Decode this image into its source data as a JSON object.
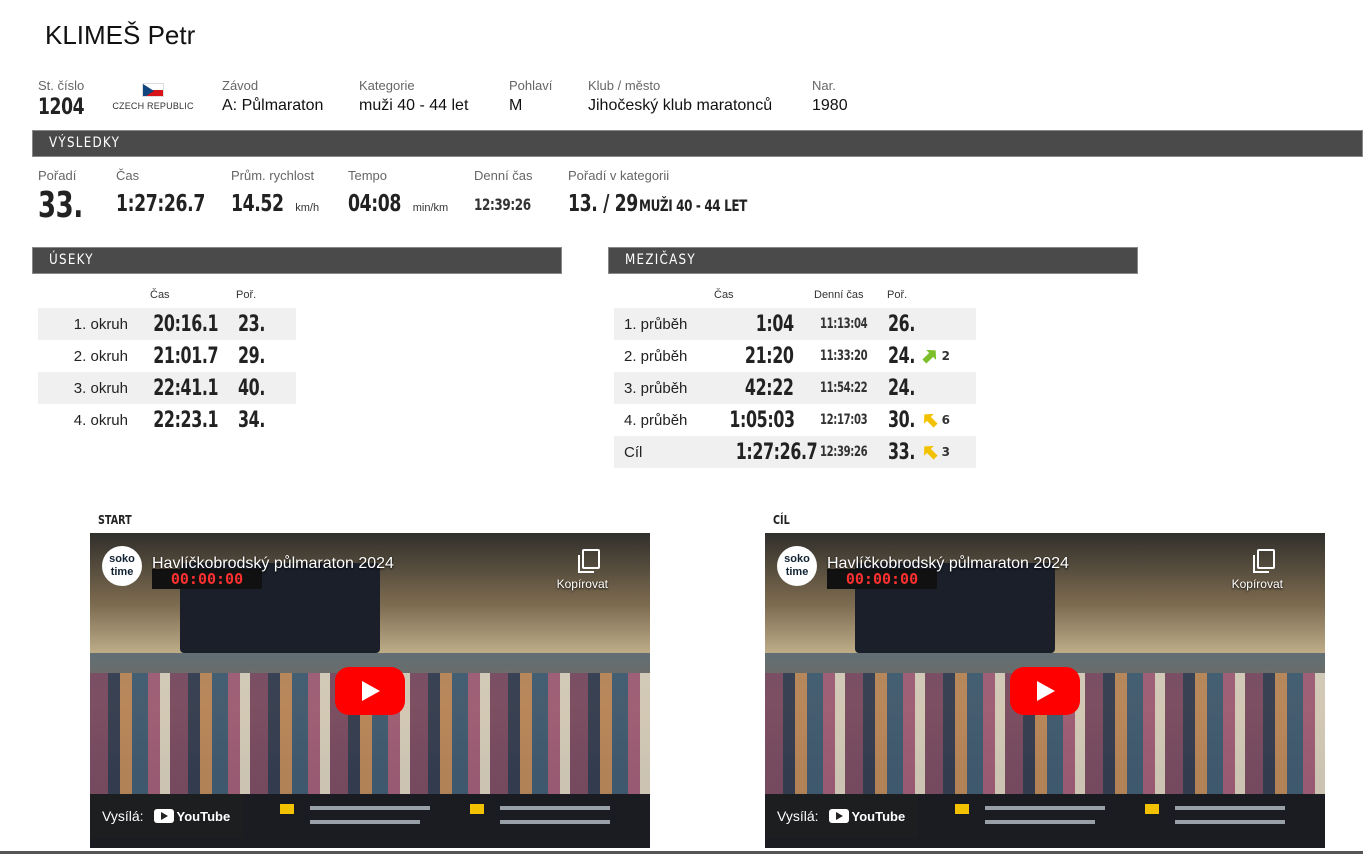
{
  "athlete": {
    "name": "KLIMEŠ Petr"
  },
  "info": {
    "bib_label": "St. číslo",
    "bib": "1204",
    "country": "CZECH REPUBLIC",
    "race_label": "Závod",
    "race": "A: Půlmaraton",
    "category_label": "Kategorie",
    "category": "muži 40 - 44 let",
    "gender_label": "Pohlaví",
    "gender": "M",
    "club_label": "Klub / město",
    "club": "Jihočeský klub maratonců",
    "born_label": "Nar.",
    "born": "1980"
  },
  "results": {
    "section_title": "VÝSLEDKY",
    "rank_label": "Pořadí",
    "rank": "33.",
    "time_label": "Čas",
    "time": "1:27:26.7",
    "speed_label": "Prům. rychlost",
    "speed": "14.52",
    "speed_unit": "km/h",
    "pace_label": "Tempo",
    "pace": "04:08",
    "pace_unit": "min/km",
    "daytime_label": "Denní čas",
    "daytime": "12:39:26",
    "catrank_label": "Pořadí v kategorii",
    "catrank": "13. / 29",
    "catrank_category": "MUŽI 40 - 44 LET"
  },
  "segments": {
    "section_title": "ÚSEKY",
    "col_time": "Čas",
    "col_rank": "Poř.",
    "rows": [
      {
        "label": "1. okruh",
        "time": "20:16.1",
        "rank": "23."
      },
      {
        "label": "2. okruh",
        "time": "21:01.7",
        "rank": "29."
      },
      {
        "label": "3. okruh",
        "time": "22:41.1",
        "rank": "40."
      },
      {
        "label": "4. okruh",
        "time": "22:23.1",
        "rank": "34."
      }
    ]
  },
  "splits": {
    "section_title": "MEZIČASY",
    "col_time": "Čas",
    "col_daytime": "Denní čas",
    "col_rank": "Poř.",
    "rows": [
      {
        "label": "1. průběh",
        "time": "1:04",
        "daytime": "11:13:04",
        "rank": "26.",
        "change": ""
      },
      {
        "label": "2. průběh",
        "time": "21:20",
        "daytime": "11:33:20",
        "rank": "24.",
        "change": "2",
        "dir": "up"
      },
      {
        "label": "3. průběh",
        "time": "42:22",
        "daytime": "11:54:22",
        "rank": "24.",
        "change": ""
      },
      {
        "label": "4. průběh",
        "time": "1:05:03",
        "daytime": "12:17:03",
        "rank": "30.",
        "change": "6",
        "dir": "down"
      },
      {
        "label": "Cíl",
        "time": "1:27:26.7",
        "daytime": "12:39:26",
        "rank": "33.",
        "change": "3",
        "dir": "down"
      }
    ]
  },
  "videos": [
    {
      "label": "START",
      "title": "Havlíčkobrodský půlmaraton 2024",
      "copy": "Kopírovat",
      "watch": "Vysílá:",
      "yt": "YouTube",
      "logo": "soko time",
      "clock": "00:00:00"
    },
    {
      "label": "CÍL",
      "title": "Havlíčkobrodský půlmaraton 2024",
      "copy": "Kopírovat",
      "watch": "Vysílá:",
      "yt": "YouTube",
      "logo": "soko time",
      "clock": "00:00:00"
    }
  ],
  "colors": {
    "bar": "#4a4a4a",
    "row_shade": "#f0f0f0",
    "up": "#7cbf2a",
    "down": "#f2c200"
  }
}
